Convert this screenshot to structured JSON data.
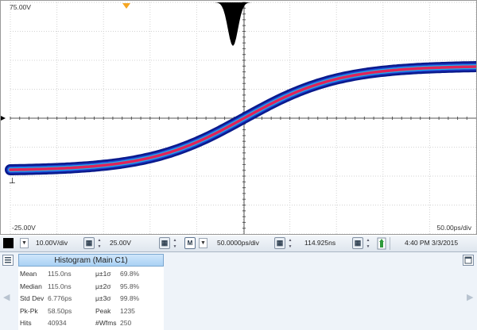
{
  "scope": {
    "y_top_label": "75.00V",
    "y_bottom_label": "-25.00V",
    "time_div_label": "50.00ps/div",
    "trace_colors": [
      "#0a1a8c",
      "#1f3fd0",
      "#22b8e8",
      "#e8e820",
      "#f0883a",
      "#e0245a"
    ],
    "marker_color": "#f5a623"
  },
  "controls": {
    "vdiv": "10.00V/div",
    "offset": "25.00V",
    "m_label": "M",
    "timebase": "50.0000ps/div",
    "position": "114.925ns",
    "datetime": "4:40 PM 3/3/2015"
  },
  "histogram": {
    "title": "Histogram (Main  C1)",
    "rows": [
      {
        "label": "Mean",
        "value": "115.0ns",
        "label2": "μ±1σ",
        "value2": "69.8%"
      },
      {
        "label": "Median",
        "value": "115.0ns",
        "label2": "μ±2σ",
        "value2": "95.8%"
      },
      {
        "label": "Std Dev",
        "value": "6.776ps",
        "label2": "μ±3σ",
        "value2": "99.8%"
      },
      {
        "label": "Pk-Pk",
        "value": "58.50ps",
        "label2": "Peak",
        "value2": "1235"
      },
      {
        "label": "Hits",
        "value": "40934",
        "label2": "#Wfms",
        "value2": "250"
      }
    ]
  }
}
